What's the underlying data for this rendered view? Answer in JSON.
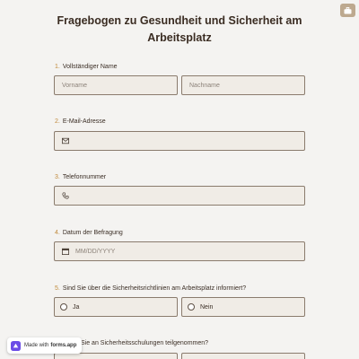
{
  "title": "Fragebogen zu Gesundheit und Sicherheit am Arbeitsplatz",
  "icons": {
    "corner": "briefcase-icon",
    "email": "envelope-icon",
    "phone": "phone-icon",
    "date": "calendar-icon",
    "badge": "forms-app-logo-icon"
  },
  "colors": {
    "accent_number": "#c08a3c",
    "field_bg": "#f0ece6",
    "field_border": "#8a7b6d",
    "corner_button": "#bda98f",
    "page_bg": "#f4f3f1"
  },
  "questions": {
    "q1": {
      "num": "1.",
      "label": "Vollständiger Name",
      "first_placeholder": "Vorname",
      "last_placeholder": "Nachname"
    },
    "q2": {
      "num": "2.",
      "label": "E-Mail-Adresse"
    },
    "q3": {
      "num": "3.",
      "label": "Telefonnummer"
    },
    "q4": {
      "num": "4.",
      "label": "Datum der Befragung",
      "placeholder": "MM/DD/YYYY"
    },
    "q5": {
      "num": "5.",
      "label": "Sind Sie über die Sicherheitsrichtlinien am Arbeitsplatz informiert?",
      "option_yes": "Ja",
      "option_no": "Nein"
    },
    "q6": {
      "label_partial": "Sie an Sicherheitsschulungen teilgenommen?"
    }
  },
  "badge": {
    "prefix": "Made with",
    "brand": "forms.app"
  }
}
